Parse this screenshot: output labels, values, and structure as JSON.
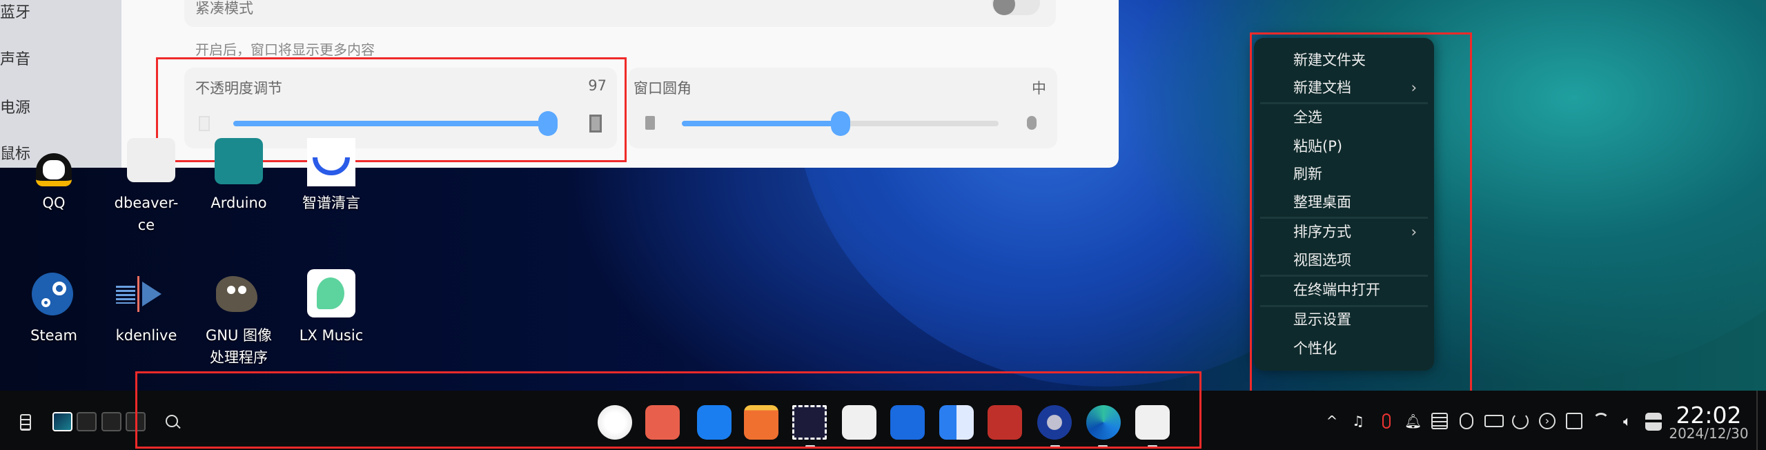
{
  "settings": {
    "sidebar": [
      "蓝牙",
      "声音",
      "电源",
      "鼠标"
    ],
    "compact_mode_label": "紧凑模式",
    "compact_hint": "开启后，窗口将显示更多内容",
    "opacity": {
      "label": "不透明度调节",
      "value": "97",
      "percent": 97
    },
    "corner": {
      "label": "窗口圆角",
      "value": "中",
      "percent": 50
    }
  },
  "desktop_icons": [
    {
      "label": "QQ"
    },
    {
      "label": "dbeaver-\nce"
    },
    {
      "label": "Arduino"
    },
    {
      "label": "智谱清言"
    },
    {
      "label": "Steam"
    },
    {
      "label": "kdenlive"
    },
    {
      "label": "GNU 图像\n处理程序"
    },
    {
      "label": "LX Music"
    }
  ],
  "context_menu": {
    "items": [
      {
        "label": "新建文件夹"
      },
      {
        "label": "新建文档",
        "submenu": true
      },
      {
        "label": "全选"
      },
      {
        "label": "粘贴(P)"
      },
      {
        "label": "刷新"
      },
      {
        "label": "整理桌面"
      },
      {
        "label": "排序方式",
        "submenu": true
      },
      {
        "label": "视图选项"
      },
      {
        "label": "在终端中打开"
      },
      {
        "label": "显示设置"
      },
      {
        "label": "个性化"
      }
    ],
    "chevron": "›"
  },
  "taskbar": {
    "apps": [
      "launcher",
      "multitasking",
      "app-store",
      "file-manager",
      "mail",
      "calendar",
      "document",
      "calculator",
      "terminal",
      "settings",
      "edge",
      "baidu-netdisk"
    ],
    "tray_icons": [
      "chevron-up",
      "music-download",
      "qq",
      "bell",
      "keyboard",
      "bluetooth",
      "battery",
      "power",
      "next",
      "sync",
      "wifi",
      "volume",
      "toggle"
    ],
    "chevron": "^",
    "time": "22:02",
    "date": "2024/12/30"
  },
  "colors": {
    "accent": "#5aa8ff",
    "highlight": "#f02a2a"
  }
}
